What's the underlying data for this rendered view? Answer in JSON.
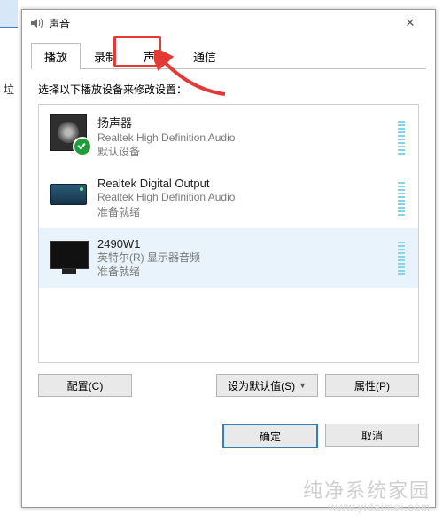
{
  "window": {
    "title": "声音"
  },
  "tabs": [
    "播放",
    "录制",
    "声音",
    "通信"
  ],
  "active_tab_index": 0,
  "highlighted_tab_index": 2,
  "instruction": "选择以下播放设备来修改设置：",
  "devices": [
    {
      "name": "扬声器",
      "desc1": "Realtek High Definition Audio",
      "desc2": "默认设备",
      "icon": "speaker",
      "selected": false,
      "default": true
    },
    {
      "name": "Realtek Digital Output",
      "desc1": "Realtek High Definition Audio",
      "desc2": "准备就绪",
      "icon": "digital",
      "selected": false,
      "default": false
    },
    {
      "name": "2490W1",
      "desc1": "英特尔(R) 显示器音频",
      "desc2": "准备就绪",
      "icon": "monitor",
      "selected": true,
      "default": false
    }
  ],
  "buttons": {
    "configure": "配置(C)",
    "set_default": "设为默认值(S)",
    "properties": "属性(P)",
    "ok": "确定",
    "cancel": "取消"
  },
  "left_strip_label": "垃",
  "watermark": {
    "line1": "纯净系统家园",
    "line2": "www.yidaimei.com"
  }
}
